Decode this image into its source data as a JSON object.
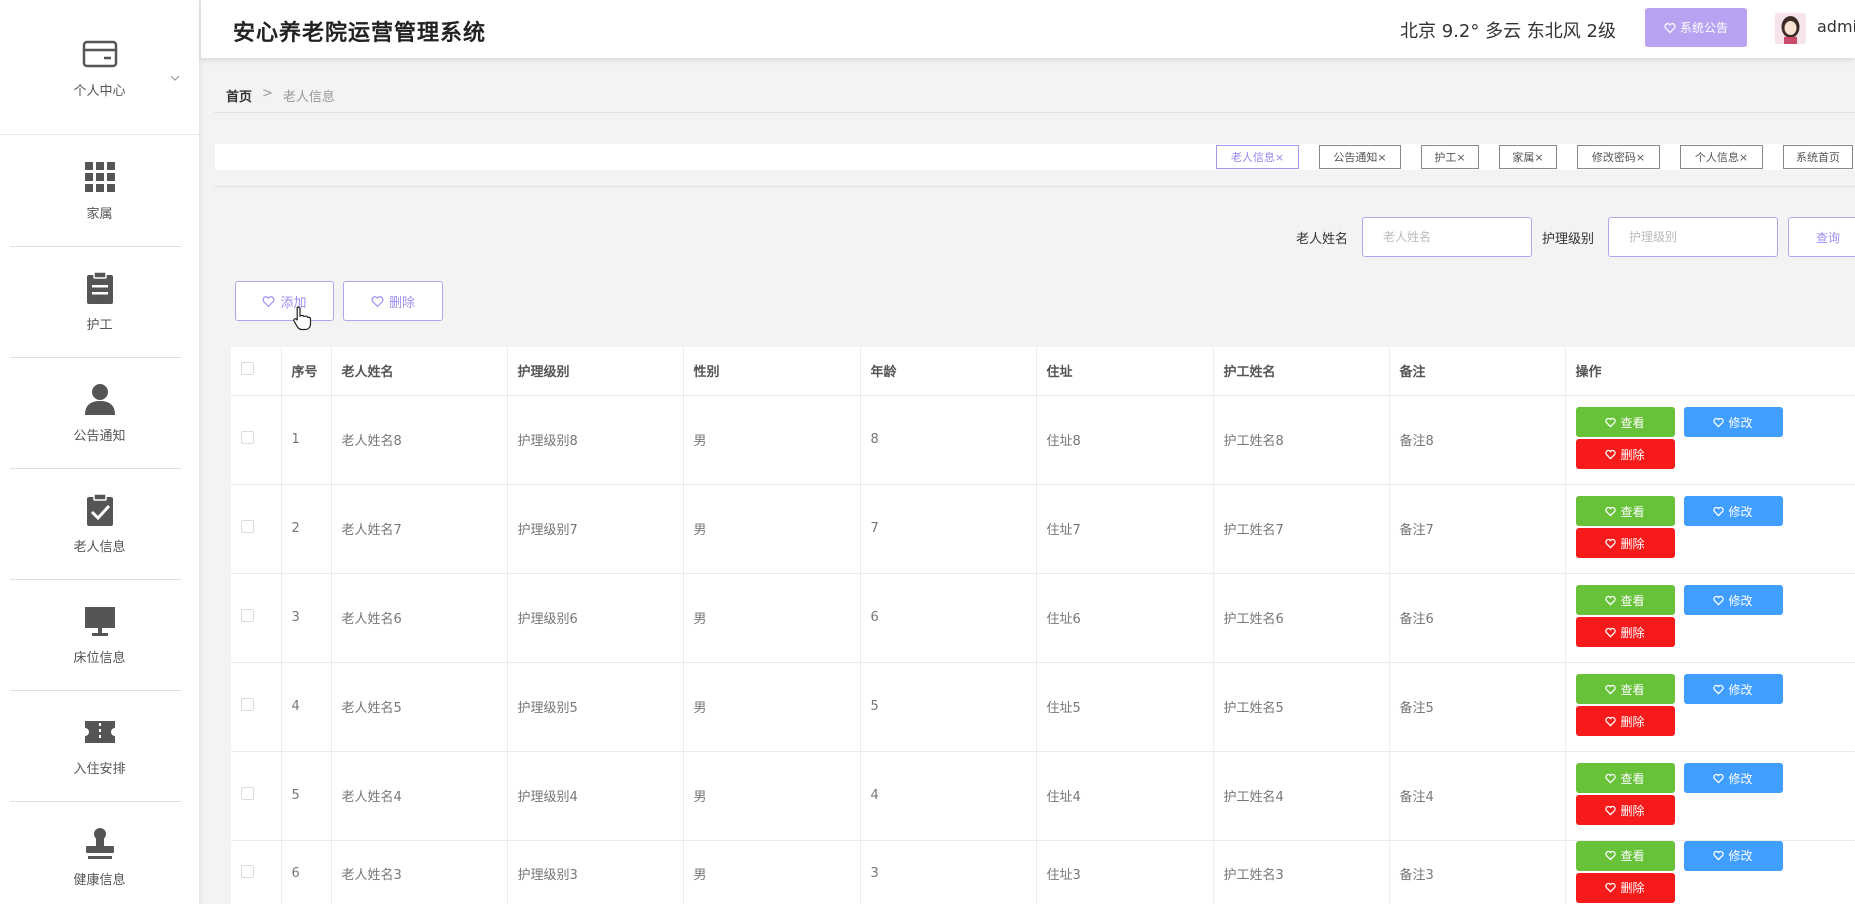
{
  "header": {
    "title": "安心养老院运营管理系统",
    "weather": "北京  9.2°  多云  东北风  2级",
    "notice_label": "系统公告",
    "username": "admin"
  },
  "sidebar": {
    "items": [
      {
        "label": "个人中心",
        "icon": "card-icon"
      },
      {
        "label": "家属",
        "icon": "grid-icon"
      },
      {
        "label": "护工",
        "icon": "clipboard-icon"
      },
      {
        "label": "公告通知",
        "icon": "user-icon"
      },
      {
        "label": "老人信息",
        "icon": "clipboard-check-icon"
      },
      {
        "label": "床位信息",
        "icon": "monitor-icon"
      },
      {
        "label": "入住安排",
        "icon": "ticket-icon"
      },
      {
        "label": "健康信息",
        "icon": "stamp-icon"
      }
    ]
  },
  "breadcrumb": {
    "home": "首页",
    "sep": ">",
    "current": "老人信息"
  },
  "tags": [
    "老人信息×",
    "公告通知×",
    "护工×",
    "家属×",
    "修改密码×",
    "个人信息×",
    "系统首页"
  ],
  "search": {
    "name_label": "老人姓名",
    "name_placeholder": "老人姓名",
    "level_label": "护理级别",
    "level_placeholder": "护理级别",
    "query_label": "查询"
  },
  "actions": {
    "add_label": "添加",
    "delete_label": "删除"
  },
  "table": {
    "columns": [
      "序号",
      "老人姓名",
      "护理级别",
      "性别",
      "年龄",
      "住址",
      "护工姓名",
      "备注",
      "操作"
    ],
    "rows": [
      {
        "no": "1",
        "name": "老人姓名8",
        "level": "护理级别8",
        "gender": "男",
        "age": "8",
        "address": "住址8",
        "nurse": "护工姓名8",
        "remark": "备注8"
      },
      {
        "no": "2",
        "name": "老人姓名7",
        "level": "护理级别7",
        "gender": "男",
        "age": "7",
        "address": "住址7",
        "nurse": "护工姓名7",
        "remark": "备注7"
      },
      {
        "no": "3",
        "name": "老人姓名6",
        "level": "护理级别6",
        "gender": "男",
        "age": "6",
        "address": "住址6",
        "nurse": "护工姓名6",
        "remark": "备注6"
      },
      {
        "no": "4",
        "name": "老人姓名5",
        "level": "护理级别5",
        "gender": "男",
        "age": "5",
        "address": "住址5",
        "nurse": "护工姓名5",
        "remark": "备注5"
      },
      {
        "no": "5",
        "name": "老人姓名4",
        "level": "护理级别4",
        "gender": "男",
        "age": "4",
        "address": "住址4",
        "nurse": "护工姓名4",
        "remark": "备注4"
      },
      {
        "no": "6",
        "name": "老人姓名3",
        "level": "护理级别3",
        "gender": "男",
        "age": "3",
        "address": "住址3",
        "nurse": "护工姓名3",
        "remark": "备注3"
      }
    ],
    "op_view": "查看",
    "op_edit": "修改",
    "op_delete": "删除"
  },
  "colors": {
    "accent": "#b7a3f2",
    "view": "#67c23a",
    "edit": "#409eff",
    "delete": "#f61a1a"
  }
}
